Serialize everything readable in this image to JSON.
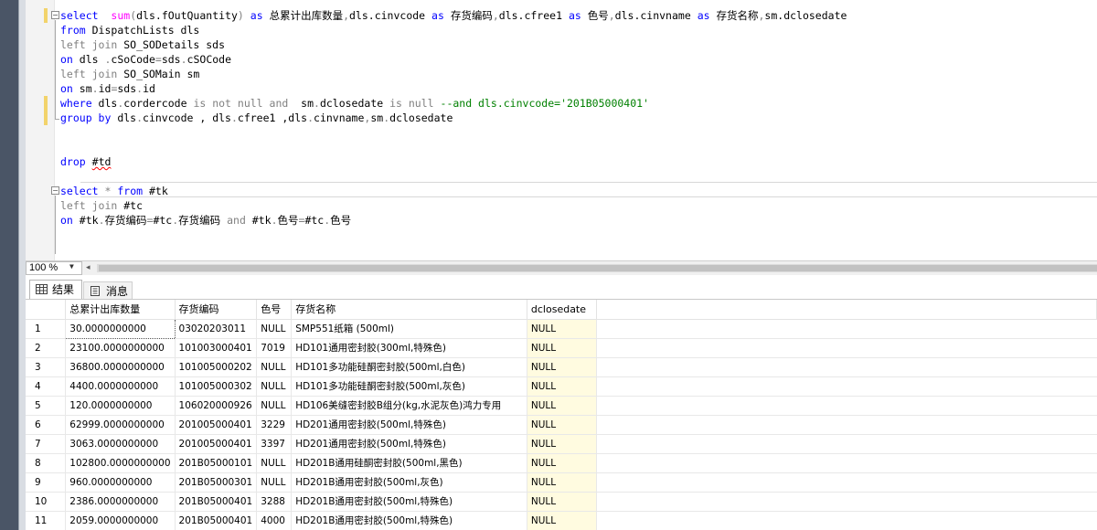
{
  "editor": {
    "lines": [
      {
        "parts": [
          [
            "kw",
            "select"
          ],
          [
            "",
            "  "
          ],
          [
            "mg",
            "sum"
          ],
          [
            "gr",
            "("
          ],
          [
            "",
            "dls.fOutQuantity"
          ],
          [
            "gr",
            ")"
          ],
          [
            "",
            " "
          ],
          [
            "kw",
            "as"
          ],
          [
            "",
            " 总累计出库数量"
          ],
          [
            "gr",
            ","
          ],
          [
            "",
            "dls.cinvcode "
          ],
          [
            "kw",
            "as"
          ],
          [
            "",
            " 存货编码"
          ],
          [
            "gr",
            ","
          ],
          [
            "",
            "dls.cfree1 "
          ],
          [
            "kw",
            "as"
          ],
          [
            "",
            " 色号"
          ],
          [
            "gr",
            ","
          ],
          [
            "",
            "dls.cinvname "
          ],
          [
            "kw",
            "as"
          ],
          [
            "",
            " 存货名称"
          ],
          [
            "gr",
            ","
          ],
          [
            "",
            "sm.dclosedate"
          ]
        ]
      },
      {
        "parts": [
          [
            "kw",
            "from"
          ],
          [
            "",
            " DispatchLists dls"
          ]
        ]
      },
      {
        "parts": [
          [
            "gr",
            "left join"
          ],
          [
            "",
            " SO_SODetails sds"
          ]
        ]
      },
      {
        "parts": [
          [
            "kw",
            "on"
          ],
          [
            "",
            " dls "
          ],
          [
            "gr",
            "."
          ],
          [
            "",
            "cSoCode"
          ],
          [
            "gr",
            "="
          ],
          [
            "",
            "sds"
          ],
          [
            "gr",
            "."
          ],
          [
            "",
            "cSOCode"
          ]
        ]
      },
      {
        "parts": [
          [
            "gr",
            "left join"
          ],
          [
            "",
            " SO_SOMain sm"
          ]
        ]
      },
      {
        "parts": [
          [
            "kw",
            "on"
          ],
          [
            "",
            " sm"
          ],
          [
            "gr",
            "."
          ],
          [
            "",
            "id"
          ],
          [
            "gr",
            "="
          ],
          [
            "",
            "sds"
          ],
          [
            "gr",
            "."
          ],
          [
            "",
            "id"
          ]
        ]
      },
      {
        "parts": [
          [
            "kw",
            "where"
          ],
          [
            "",
            " dls"
          ],
          [
            "gr",
            "."
          ],
          [
            "",
            "cordercode "
          ],
          [
            "gr",
            "is not null and"
          ],
          [
            "",
            "  sm"
          ],
          [
            "gr",
            "."
          ],
          [
            "",
            "dclosedate "
          ],
          [
            "gr",
            "is null"
          ],
          [
            "",
            " "
          ],
          [
            "cm",
            "--and dls.cinvcode='201B05000401'"
          ]
        ]
      },
      {
        "parts": [
          [
            "kw",
            "group by"
          ],
          [
            "",
            " dls"
          ],
          [
            "gr",
            "."
          ],
          [
            "",
            "cinvcode , dls"
          ],
          [
            "gr",
            "."
          ],
          [
            "",
            "cfree1 ,dls"
          ],
          [
            "gr",
            "."
          ],
          [
            "",
            "cinvname"
          ],
          [
            "gr",
            ","
          ],
          [
            "",
            "sm"
          ],
          [
            "gr",
            "."
          ],
          [
            "",
            "dclosedate"
          ]
        ]
      },
      {
        "parts": []
      },
      {
        "parts": []
      },
      {
        "parts": [
          [
            "kw",
            "drop"
          ],
          [
            "",
            " "
          ],
          [
            "sq",
            "#td"
          ]
        ]
      },
      {
        "parts": []
      },
      {
        "parts": [
          [
            "kw",
            "select"
          ],
          [
            "",
            " "
          ],
          [
            "gr",
            "*"
          ],
          [
            "",
            " "
          ],
          [
            "kw",
            "from"
          ],
          [
            "",
            " #tk"
          ]
        ]
      },
      {
        "parts": [
          [
            "gr",
            "left join"
          ],
          [
            "",
            " #tc"
          ]
        ]
      },
      {
        "parts": [
          [
            "kw",
            "on"
          ],
          [
            "",
            " #tk"
          ],
          [
            "gr",
            "."
          ],
          [
            "",
            "存货编码"
          ],
          [
            "gr",
            "="
          ],
          [
            "",
            "#tc"
          ],
          [
            "gr",
            "."
          ],
          [
            "",
            "存货编码 "
          ],
          [
            "gr",
            "and"
          ],
          [
            "",
            " #tk"
          ],
          [
            "gr",
            "."
          ],
          [
            "",
            "色号"
          ],
          [
            "gr",
            "="
          ],
          [
            "",
            "#tc"
          ],
          [
            "gr",
            "."
          ],
          [
            "",
            "色号"
          ]
        ]
      }
    ]
  },
  "zoom": {
    "value": "100 %"
  },
  "tabs": {
    "results": "结果",
    "messages": "消息"
  },
  "grid": {
    "columns": [
      "总累计出库数量",
      "存货编码",
      "色号",
      "存货名称",
      "dclosedate"
    ],
    "rows": [
      [
        "1",
        "30.0000000000",
        "03020203011",
        "NULL",
        "SMP551纸箱 (500ml)",
        "NULL"
      ],
      [
        "2",
        "23100.0000000000",
        "101003000401",
        "7019",
        "HD101通用密封胶(300ml,特殊色)",
        "NULL"
      ],
      [
        "3",
        "36800.0000000000",
        "101005000202",
        "NULL",
        "HD101多功能硅酮密封胶(500ml,白色)",
        "NULL"
      ],
      [
        "4",
        "4400.0000000000",
        "101005000302",
        "NULL",
        "HD101多功能硅酮密封胶(500ml,灰色)",
        "NULL"
      ],
      [
        "5",
        "120.0000000000",
        "106020000926",
        "NULL",
        "HD106美缝密封胶B组分(kg,水泥灰色)鸿力专用",
        "NULL"
      ],
      [
        "6",
        "62999.0000000000",
        "201005000401",
        "3229",
        "HD201通用密封胶(500ml,特殊色)",
        "NULL"
      ],
      [
        "7",
        "3063.0000000000",
        "201005000401",
        "3397",
        "HD201通用密封胶(500ml,特殊色)",
        "NULL"
      ],
      [
        "8",
        "102800.0000000000",
        "201B05000101",
        "NULL",
        "HD201B通用硅酮密封胶(500ml,黑色)",
        "NULL"
      ],
      [
        "9",
        "960.0000000000",
        "201B05000301",
        "NULL",
        "HD201B通用密封胶(500ml,灰色)",
        "NULL"
      ],
      [
        "10",
        "2386.0000000000",
        "201B05000401",
        "3288",
        "HD201B通用密封胶(500ml,特殊色)",
        "NULL"
      ],
      [
        "11",
        "2059.0000000000",
        "201B05000401",
        "4000",
        "HD201B通用密封胶(500ml,特殊色)",
        "NULL"
      ]
    ]
  }
}
